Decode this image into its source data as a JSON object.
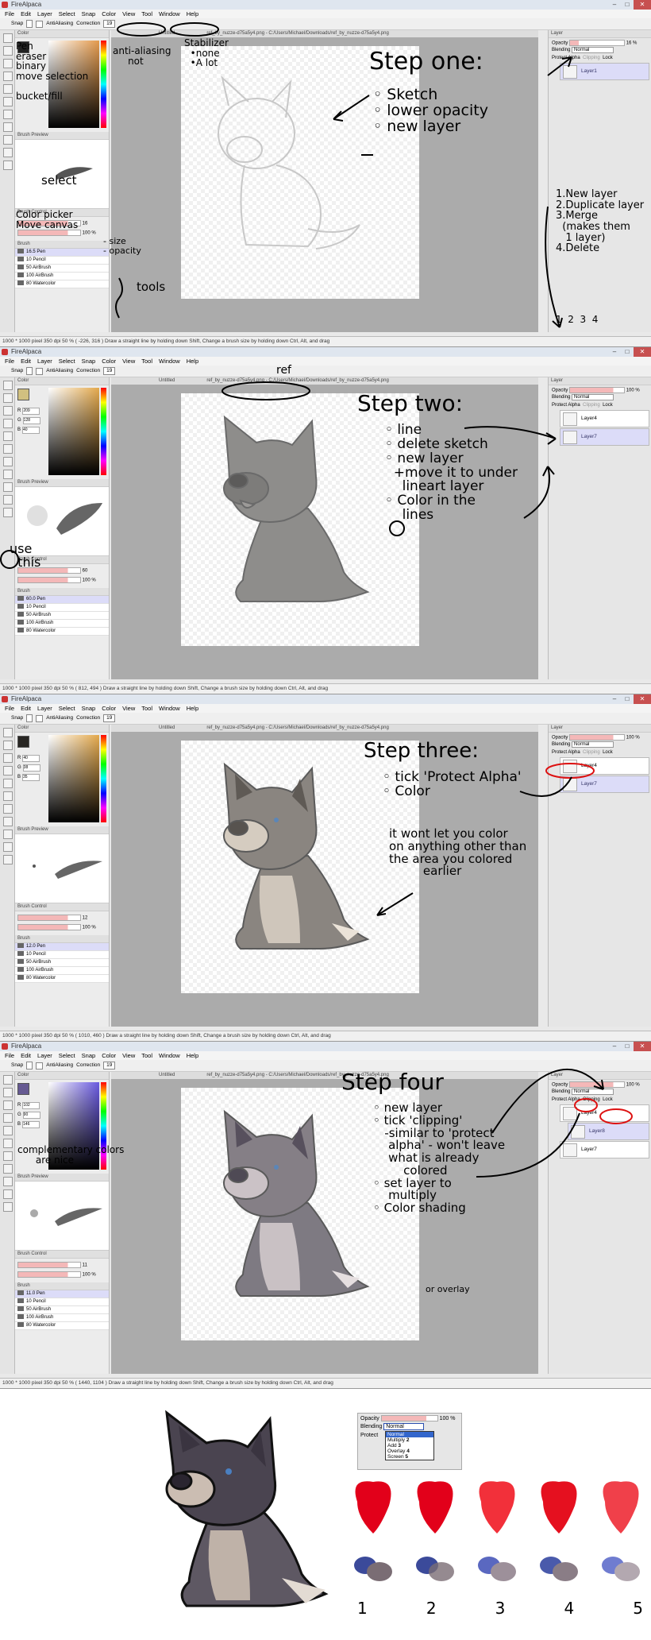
{
  "app": {
    "title": "FireAlpaca",
    "menu": [
      "File",
      "Edit",
      "Layer",
      "Select",
      "Snap",
      "Color",
      "View",
      "Tool",
      "Window",
      "Help"
    ],
    "snap_label": "Snap",
    "antialiasing": "AntiAliasing",
    "correction_label": "Correction",
    "correction_value": "19",
    "panel_color": "Color",
    "panel_brush_preview": "Brush Preview",
    "panel_brush_control": "Brush Control",
    "panel_brush": "Brush",
    "panel_layer": "Layer",
    "opacity_label": "Opacity",
    "blending_label": "Blending",
    "blending_value": "Normal",
    "protect_alpha": "Protect Alpha",
    "clipping": "Clipping",
    "lock": "Lock",
    "tab_untitled": "Untitled",
    "tab_ref": "ref_by_nuzze-d75a5y4.png - C:/Users/Michael/Downloads/ref_by_nuzze-d75a5y4.png",
    "brush_sizes": [
      "10",
      "50",
      "100",
      "80"
    ],
    "brush_names": [
      "Pencil",
      "AirBrush",
      "AirBrush",
      "Watercolor"
    ],
    "brush_pen": "Pen"
  },
  "screens": [
    {
      "brush_size": "16.5",
      "opacity_pct": "16 %",
      "brush_opacity": "100 %",
      "brush_size_value": "16",
      "color_rgb": {
        "r": "",
        "g": "",
        "b": ""
      },
      "layers": [
        "Layer1"
      ],
      "status": "1000 * 1000 pixel  350 dpi  50 %  ( -226, 316 )   Draw a straight line by holding down Shift, Change a brush size by holding down Ctrl, Alt, and drag",
      "notes": {
        "pen": "Pen\neraser\nbinary\nmove selection\n\nbucket/fill",
        "anti": "anti-aliasing\n     not",
        "stab": "Stabilizer\n  •none\n  •A lot",
        "select": "select",
        "picker": "Color picker\nMove canvas",
        "size": "- size\n- opacity",
        "tools": "tools",
        "title": "Step one:",
        "list": "◦ Sketch\n◦ lower opacity\n◦ new layer",
        "layers": "1.New layer\n2.Duplicate layer\n3.Merge\n  (makes them\n   1 layer)\n4.Delete",
        "nums": "1  2  3  4"
      }
    },
    {
      "brush_size": "60.0",
      "opacity_pct": "100 %",
      "brush_opacity": "100 %",
      "brush_size_value": "60",
      "color_rgb": {
        "r": "209",
        "g": "128",
        "b": "40"
      },
      "layers": [
        "Layer4",
        "Layer7"
      ],
      "status": "1000 * 1000 pixel  350 dpi  50 %  ( 812, 494 )   Draw a straight line by holding down Shift, Change a brush size by holding down Ctrl, Alt, and drag",
      "notes": {
        "ref": "ref",
        "title": "Step two:",
        "list": "◦ line\n◦ delete sketch\n◦ new layer\n  +move it to under\n    lineart layer\n◦ Color in the\n    lines",
        "use": "use\n  this"
      }
    },
    {
      "brush_size": "12.0",
      "opacity_pct": "100 %",
      "brush_opacity": "100 %",
      "brush_size_value": "12",
      "color_rgb": {
        "r": "40",
        "g": "38",
        "b": "35"
      },
      "layers": [
        "Layer4",
        "Layer7"
      ],
      "status": "1000 * 1000 pixel  350 dpi  50 %  ( 1010, 460 )   Draw a straight line by holding down Shift, Change a brush size by holding down Ctrl, Alt, and drag",
      "notes": {
        "title": "Step three:",
        "list": "◦ tick 'Protect Alpha'\n◦ Color",
        "body": "it wont let you color\non anything other than\nthe area you colored\n         earlier"
      }
    },
    {
      "brush_size": "11.0",
      "opacity_pct": "100 %",
      "brush_opacity": "100 %",
      "brush_size_value": "11",
      "color_rgb": {
        "r": "102",
        "g": "90",
        "b": "146"
      },
      "layers": [
        "Layer4",
        "Layer8",
        "Layer7"
      ],
      "status": "1000 * 1000 pixel  350 dpi  50 %  ( 1440, 1104 )   Draw a straight line by holding down Shift, Change a brush size by holding down Ctrl, Alt, and drag",
      "notes": {
        "comp": "complementary colors\n      are nice",
        "title": "Step four",
        "list": "◦ new layer\n◦ tick 'clipping'\n   -similar to 'protect\n    alpha' - won't leave\n    what is already\n        colored\n◦ set layer to\n    multiply\n◦ Color shading",
        "overlay": "or overlay"
      }
    }
  ],
  "bottom": {
    "opacity_label": "Opacity",
    "opacity_value": "100 %",
    "blending_label": "Blending",
    "blending_value": "Normal",
    "blend_options": [
      "Normal",
      "Multiply",
      "Add",
      "Overlay",
      "Screen"
    ],
    "blend_nums": [
      "2",
      "3",
      "4",
      "5"
    ],
    "protect": "Protect",
    "sample_labels": [
      "1",
      "2",
      "3",
      "4",
      "5"
    ]
  }
}
